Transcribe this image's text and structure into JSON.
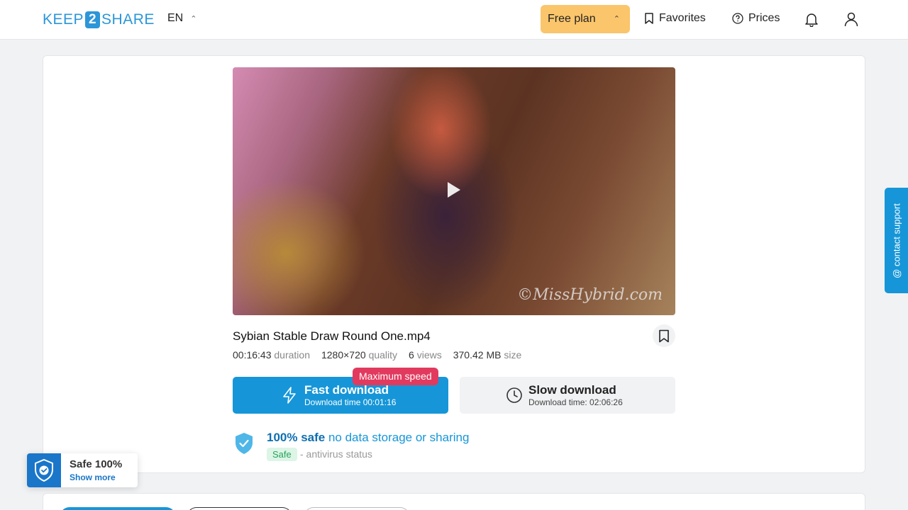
{
  "header": {
    "logo": {
      "pre": "KEEP",
      "mid": "2",
      "post": "SHARE"
    },
    "language": "EN",
    "plan_label": "Free plan",
    "favorites_label": "Favorites",
    "prices_label": "Prices"
  },
  "file": {
    "name": "Sybian Stable Draw Round One.mp4",
    "watermark": "©MissHybrid.com",
    "duration_value": "00:16:43",
    "duration_label": "duration",
    "quality_value": "1280×720",
    "quality_label": "quality",
    "views_value": "6",
    "views_label": "views",
    "size_value": "370.42 MB",
    "size_label": "size"
  },
  "download": {
    "badge": "Maximum speed",
    "fast_title": "Fast download",
    "fast_time": "Download time 00:01:16",
    "slow_title": "Slow download",
    "slow_time": "Download time: 02:06:26"
  },
  "safety": {
    "bold": "100% safe",
    "rest": "no data storage or sharing",
    "badge": "Safe",
    "status": "- antivirus status"
  },
  "support_label": "@ contact support",
  "widget": {
    "title": "Safe 100%",
    "link": "Show more"
  },
  "colors": {
    "accent": "#1696d8",
    "plan": "#fbc56b",
    "badge": "#e23a5e"
  }
}
